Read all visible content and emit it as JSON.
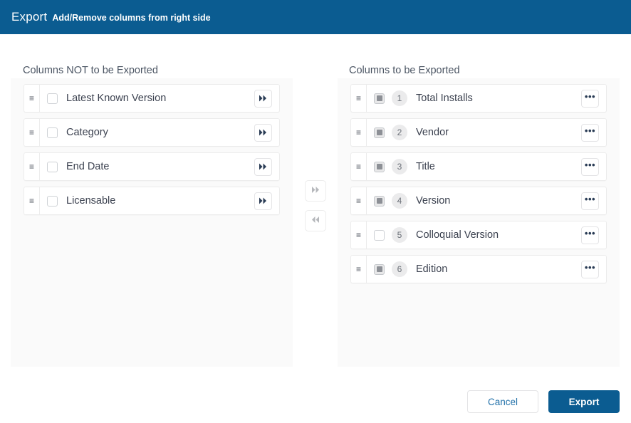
{
  "header": {
    "title": "Export",
    "subtitle": "Add/Remove columns from right side",
    "background_color": "#0b5c91",
    "text_color": "#ffffff"
  },
  "left_panel": {
    "heading": "Columns NOT to be Exported",
    "items": [
      {
        "label": "Latest Known Version",
        "checked": false,
        "action_icon": "double-chevron-right-icon"
      },
      {
        "label": "Category",
        "checked": false,
        "action_icon": "double-chevron-right-icon"
      },
      {
        "label": "End Date",
        "checked": false,
        "action_icon": "double-chevron-right-icon"
      },
      {
        "label": "Licensable",
        "checked": false,
        "action_icon": "double-chevron-right-icon"
      }
    ]
  },
  "right_panel": {
    "heading": "Columns to be Exported",
    "items": [
      {
        "order": "1",
        "label": "Total Installs",
        "checked": true,
        "action_icon": "ellipsis-icon"
      },
      {
        "order": "2",
        "label": "Vendor",
        "checked": true,
        "action_icon": "ellipsis-icon"
      },
      {
        "order": "3",
        "label": "Title",
        "checked": true,
        "action_icon": "ellipsis-icon"
      },
      {
        "order": "4",
        "label": "Version",
        "checked": true,
        "action_icon": "ellipsis-icon"
      },
      {
        "order": "5",
        "label": "Colloquial Version",
        "checked": false,
        "action_icon": "ellipsis-icon"
      },
      {
        "order": "6",
        "label": "Edition",
        "checked": true,
        "action_icon": "ellipsis-icon"
      }
    ]
  },
  "transfer": {
    "move_right_icon": "double-chevron-right-icon",
    "move_left_icon": "double-chevron-left-icon"
  },
  "footer": {
    "cancel_label": "Cancel",
    "export_label": "Export",
    "export_color": "#0b5c91",
    "cancel_text_color": "#1f6fa8"
  },
  "icons": {
    "drag_handle": "drag-handle-icon",
    "ellipsis": "•••"
  }
}
